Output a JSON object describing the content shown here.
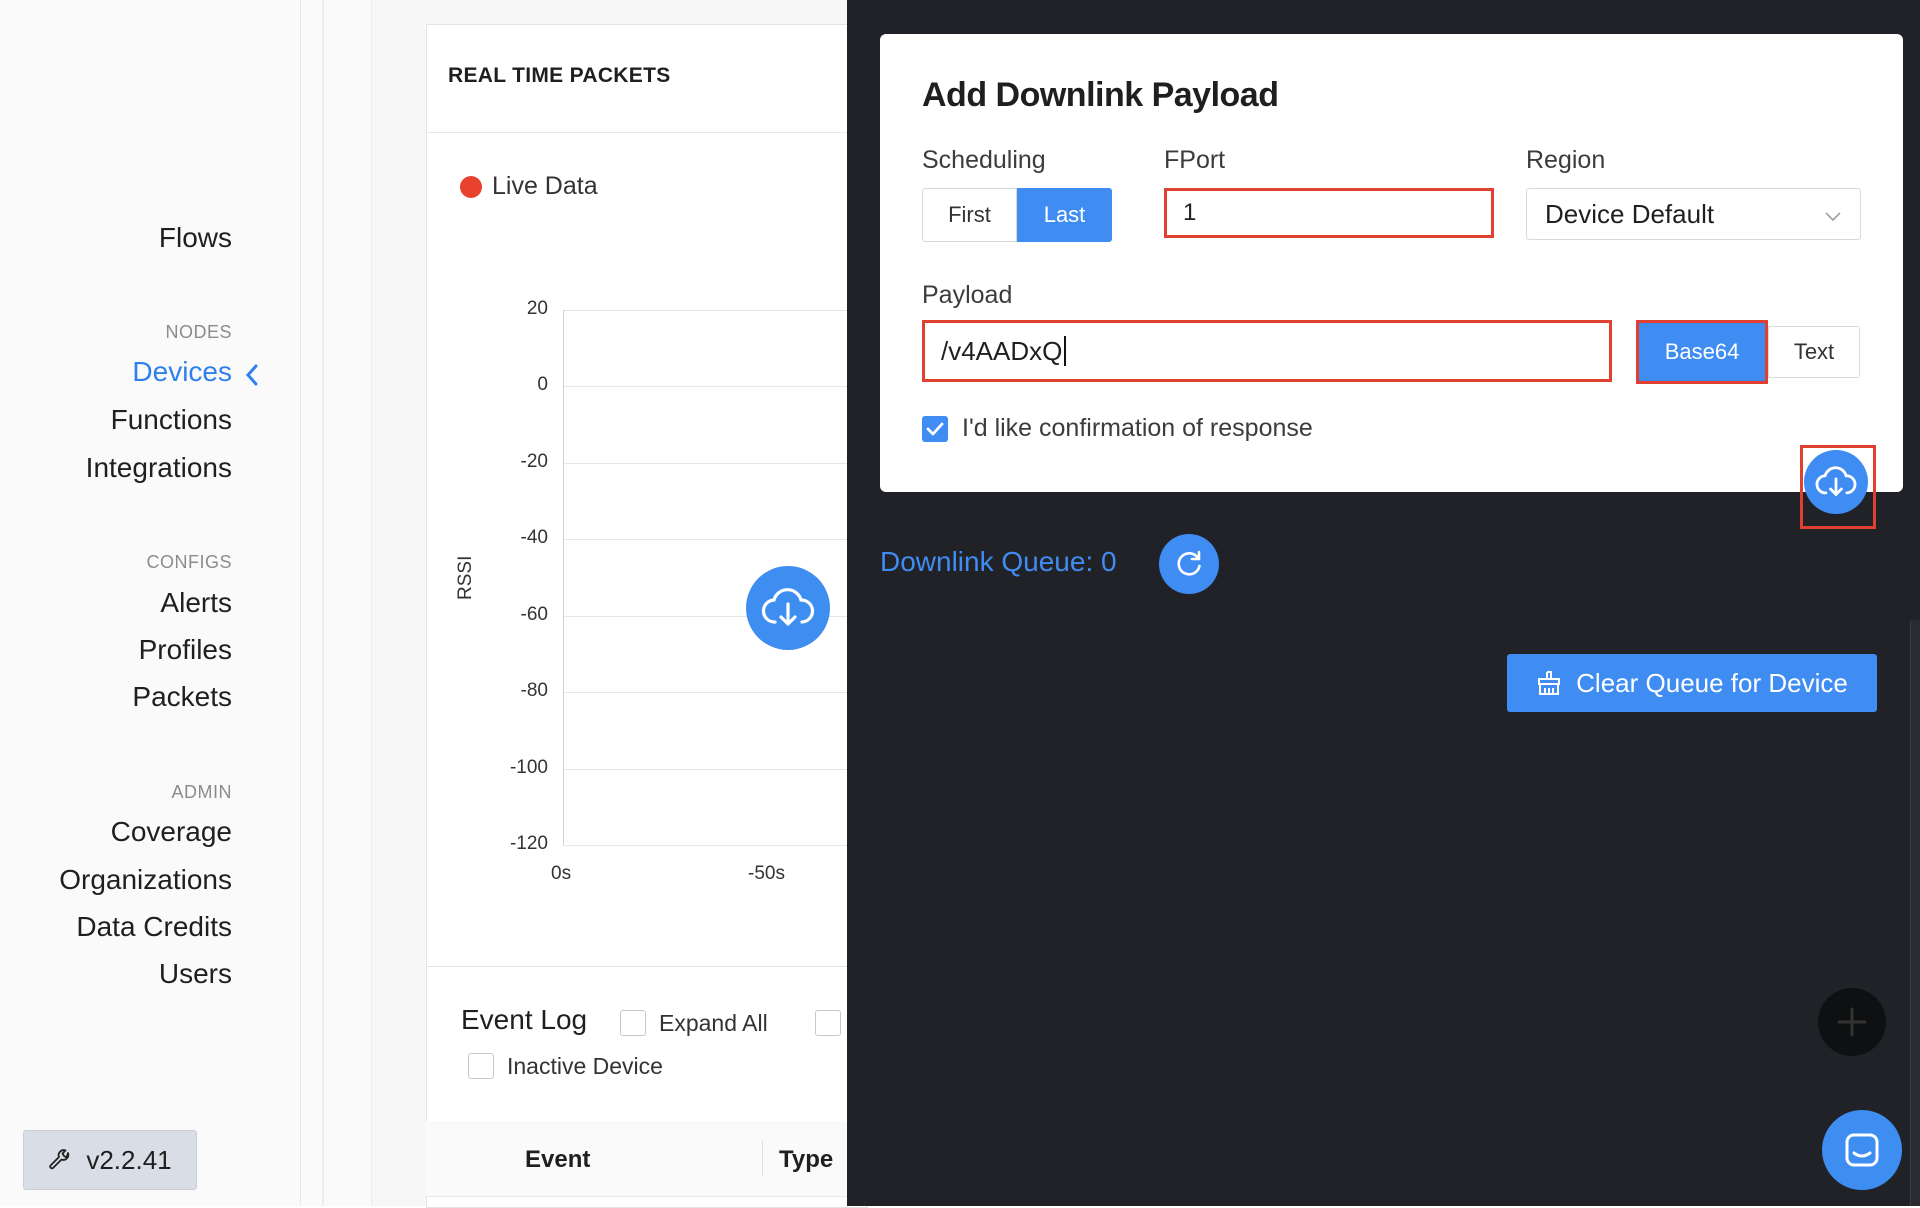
{
  "sidebar": {
    "flows_label": "Flows",
    "nodes_header": "NODES",
    "nodes": [
      "Devices",
      "Functions",
      "Integrations"
    ],
    "configs_header": "CONFIGS",
    "configs": [
      "Alerts",
      "Profiles",
      "Packets"
    ],
    "admin_header": "ADMIN",
    "admin": [
      "Coverage",
      "Organizations",
      "Data Credits",
      "Users"
    ],
    "version": "v2.2.41"
  },
  "packets_panel": {
    "title": "REAL TIME PACKETS",
    "live_label": "Live Data",
    "event_log_title": "Event Log",
    "expand_all_label": "Expand All",
    "inactive_device_label": "Inactive Device",
    "table_headers": [
      "Event",
      "Type"
    ]
  },
  "chart_data": {
    "type": "scatter",
    "title": "",
    "xlabel": "",
    "ylabel": "RSSI",
    "y_ticks": [
      "20",
      "0",
      "-20",
      "-40",
      "-60",
      "-80",
      "-100",
      "-120"
    ],
    "x_ticks": [
      "0s",
      "-50s"
    ],
    "ylim": [
      -120,
      20
    ],
    "series": []
  },
  "downlink": {
    "title": "Add Downlink Payload",
    "scheduling_label": "Scheduling",
    "scheduling_options": [
      "First",
      "Last"
    ],
    "scheduling_selected": "Last",
    "fport_label": "FPort",
    "fport_value": "1",
    "region_label": "Region",
    "region_value": "Device Default",
    "payload_label": "Payload",
    "payload_value": "/v4AADxQ",
    "format_options": [
      "Base64",
      "Text"
    ],
    "format_selected": "Base64",
    "confirm_label": "I'd like confirmation of response",
    "confirm_checked": true,
    "queue_label": "Downlink Queue: 0",
    "clear_label": "Clear Queue for Device"
  },
  "colors": {
    "accent": "#3f8cf2",
    "highlight_box": "#e0402f",
    "drawer_bg": "#212227",
    "live_dot": "#e8412e"
  },
  "icons": [
    "chevron-left-icon",
    "wrench-icon",
    "cloud-download-icon",
    "refresh-icon",
    "broom-icon",
    "plus-icon",
    "chat-icon",
    "check-icon",
    "chevron-down-icon"
  ]
}
